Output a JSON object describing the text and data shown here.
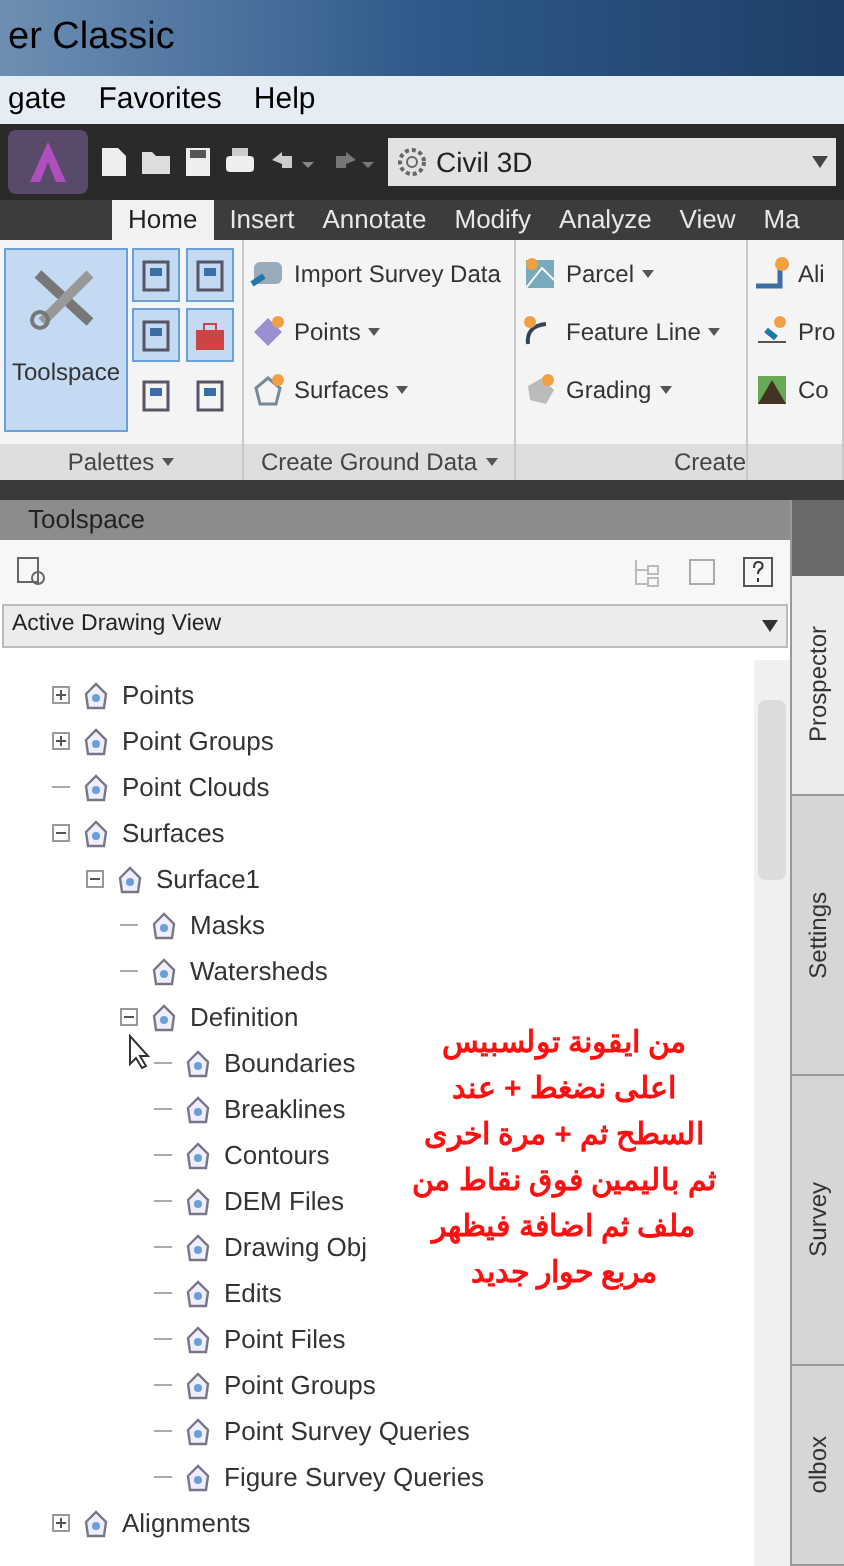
{
  "window": {
    "title": "er Classic"
  },
  "menu": [
    "gate",
    "Favorites",
    "Help"
  ],
  "workspace": {
    "value": "Civil 3D"
  },
  "ribbon_tabs": [
    {
      "label": "Home",
      "selected": true
    },
    {
      "label": "Insert",
      "selected": false
    },
    {
      "label": "Annotate",
      "selected": false
    },
    {
      "label": "Modify",
      "selected": false
    },
    {
      "label": "Analyze",
      "selected": false
    },
    {
      "label": "View",
      "selected": false
    },
    {
      "label": "Ma",
      "selected": false
    }
  ],
  "ribbon_groups": [
    {
      "label": "Palettes",
      "items": [
        {
          "label": "Toolspace",
          "selected": true
        }
      ]
    },
    {
      "label": "Create Ground Data",
      "items": [
        {
          "label": "Import Survey Data"
        },
        {
          "label": "Points",
          "dropdown": true
        },
        {
          "label": "Surfaces",
          "dropdown": true
        }
      ]
    },
    {
      "label": "Create",
      "items": [
        {
          "label": "Parcel",
          "dropdown": true
        },
        {
          "label": "Feature Line",
          "dropdown": true
        },
        {
          "label": "Grading",
          "dropdown": true
        }
      ]
    },
    {
      "items": [
        {
          "label": "Ali"
        },
        {
          "label": "Pro"
        },
        {
          "label": "Co"
        }
      ]
    }
  ],
  "toolspace": {
    "title": "Toolspace",
    "view": "Active Drawing View",
    "tree": [
      {
        "label": "Points",
        "expanded": false
      },
      {
        "label": "Point Groups",
        "expanded": false
      },
      {
        "label": "Point Clouds"
      },
      {
        "label": "Surfaces",
        "expanded": true,
        "children": [
          {
            "label": "Surface1",
            "expanded": true,
            "children": [
              {
                "label": "Masks"
              },
              {
                "label": "Watersheds"
              },
              {
                "label": "Definition",
                "expanded": true,
                "children": [
                  {
                    "label": "Boundaries"
                  },
                  {
                    "label": "Breaklines"
                  },
                  {
                    "label": "Contours"
                  },
                  {
                    "label": "DEM Files"
                  },
                  {
                    "label": "Drawing Obj"
                  },
                  {
                    "label": "Edits"
                  },
                  {
                    "label": "Point Files"
                  },
                  {
                    "label": "Point Groups"
                  },
                  {
                    "label": "Point Survey Queries"
                  },
                  {
                    "label": "Figure Survey Queries"
                  }
                ]
              }
            ]
          }
        ]
      },
      {
        "label": "Alignments",
        "expanded": false
      }
    ],
    "side_tabs": [
      {
        "label": "Prospector",
        "selected": true
      },
      {
        "label": "Settings",
        "selected": false
      },
      {
        "label": "Survey",
        "selected": false
      },
      {
        "label": "olbox",
        "selected": false
      }
    ]
  },
  "annotation": {
    "lines": [
      "من ايقونة تولسبيس",
      "اعلى نضغط + عند",
      "السطح ثم + مرة اخرى",
      "ثم باليمين فوق نقاط من",
      "ملف ثم اضافة فيظهر",
      "مربع حوار جديد"
    ]
  }
}
